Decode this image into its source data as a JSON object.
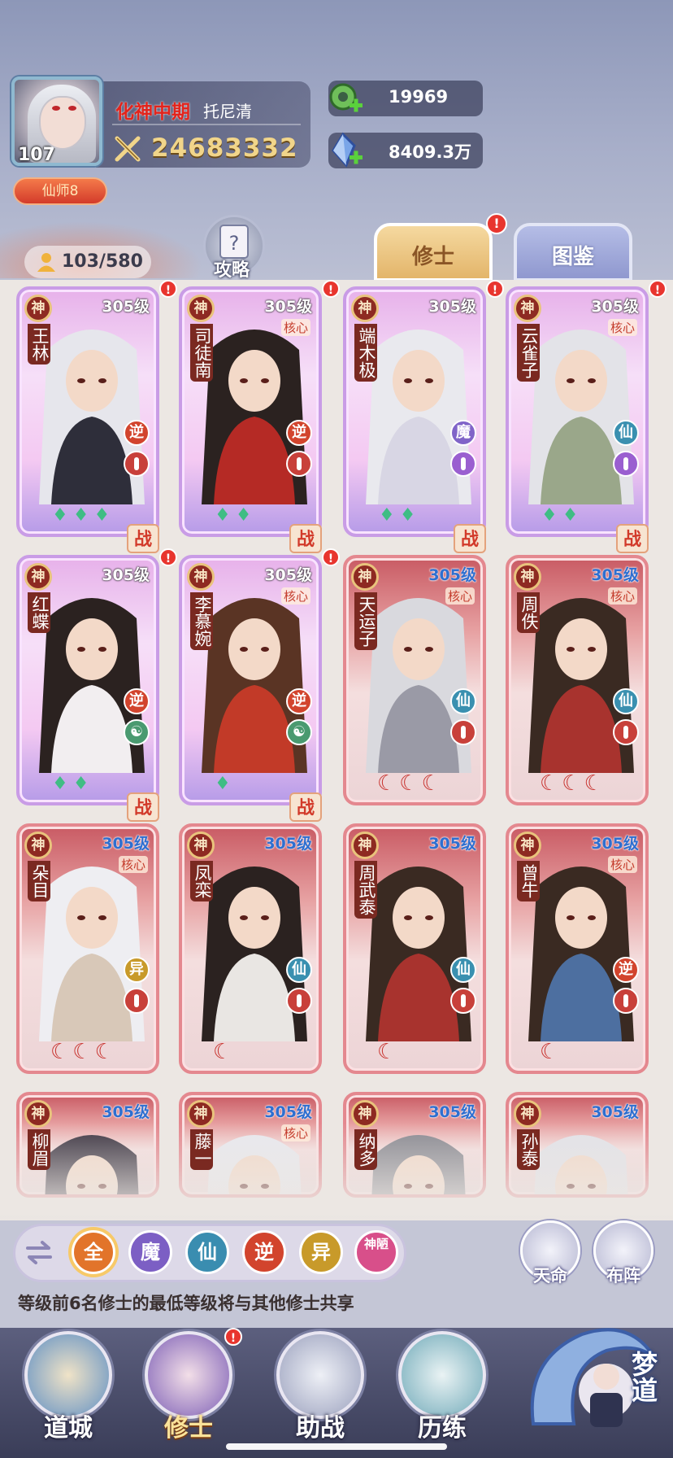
{
  "player": {
    "level": "107",
    "realm": "化神中期",
    "name": "托尼清",
    "power": "24683332",
    "title": "仙师8"
  },
  "resources": [
    {
      "name": "jade-coin",
      "value": "19969"
    },
    {
      "name": "spirit-crystal",
      "value": "8409.3万"
    }
  ],
  "roster": {
    "count": "103/580"
  },
  "strategy": {
    "label": "攻略"
  },
  "tabs": [
    {
      "label": "修士",
      "active": true
    },
    {
      "label": "图鉴",
      "active": false
    }
  ],
  "cards": [
    {
      "badge": "神",
      "name": "王林",
      "level": "305级",
      "core": "",
      "faction": "逆",
      "role": "attack",
      "pips": "♦♦♦",
      "style": "gold",
      "deployed": true
    },
    {
      "badge": "神",
      "name": "司徒南",
      "level": "305级",
      "core": "核心",
      "faction": "逆",
      "role": "attack",
      "pips": "♦♦",
      "style": "gold",
      "deployed": true
    },
    {
      "badge": "神",
      "name": "端木极",
      "level": "305级",
      "core": "",
      "faction": "魔",
      "role": "heal",
      "pips": "♦♦",
      "style": "gold",
      "deployed": true
    },
    {
      "badge": "神",
      "name": "云雀子",
      "level": "305级",
      "core": "核心",
      "faction": "仙",
      "role": "heal",
      "pips": "♦♦",
      "style": "gold",
      "deployed": true
    },
    {
      "badge": "神",
      "name": "红蝶",
      "level": "305级",
      "core": "",
      "faction": "逆",
      "role": "yinyang",
      "pips": "♦♦",
      "style": "gold",
      "deployed": true
    },
    {
      "badge": "神",
      "name": "李慕婉",
      "level": "305级",
      "core": "核心",
      "faction": "逆",
      "role": "yinyang",
      "pips": "♦",
      "style": "gold",
      "deployed": true
    },
    {
      "badge": "神",
      "name": "天运子",
      "level": "305级",
      "core": "核心",
      "faction": "仙",
      "role": "attack",
      "moons": "☾☾☾",
      "style": "red",
      "deployed": false
    },
    {
      "badge": "神",
      "name": "周佚",
      "level": "305级",
      "core": "核心",
      "faction": "仙",
      "role": "attack",
      "moons": "☾☾☾",
      "style": "red",
      "deployed": false
    },
    {
      "badge": "神",
      "name": "朵目",
      "level": "305级",
      "core": "核心",
      "faction": "异",
      "role": "attack",
      "moons": "☾☾☾",
      "style": "red",
      "deployed": false
    },
    {
      "badge": "神",
      "name": "凤栾",
      "level": "305级",
      "core": "",
      "faction": "仙",
      "role": "attack",
      "moons": "☾",
      "style": "red",
      "deployed": false
    },
    {
      "badge": "神",
      "name": "周武泰",
      "level": "305级",
      "core": "",
      "faction": "仙",
      "role": "attack",
      "moons": "☾",
      "style": "red",
      "deployed": false
    },
    {
      "badge": "神",
      "name": "曾牛",
      "level": "305级",
      "core": "核心",
      "faction": "逆",
      "role": "attack",
      "moons": "☾",
      "style": "red",
      "deployed": false
    },
    {
      "badge": "神",
      "name": "柳眉",
      "level": "305级",
      "core": "",
      "style": "red"
    },
    {
      "badge": "神",
      "name": "藤一",
      "level": "305级",
      "core": "核心",
      "style": "red"
    },
    {
      "badge": "神",
      "name": "纳多",
      "level": "305级",
      "core": "",
      "style": "red"
    },
    {
      "badge": "神",
      "name": "孙泰",
      "level": "305级",
      "core": "",
      "style": "red"
    }
  ],
  "deployed_label": "战",
  "notification_mark": "!",
  "filters": [
    {
      "label": "全",
      "color": "#e2742a"
    },
    {
      "label": "魔",
      "color": "#7c5fc4"
    },
    {
      "label": "仙",
      "color": "#3a8db0"
    },
    {
      "label": "逆",
      "color": "#d2442d"
    },
    {
      "label": "异",
      "color": "#c89a2a"
    },
    {
      "label": "神陋",
      "color": "#d84f8a"
    }
  ],
  "side_buttons": [
    {
      "label": "天命"
    },
    {
      "label": "布阵"
    }
  ],
  "hint": "等级前6名修士的最低等级将与其他修士共享",
  "nav": [
    {
      "label": "道城"
    },
    {
      "label": "修士",
      "active": true
    },
    {
      "label": "助战"
    },
    {
      "label": "历练"
    }
  ],
  "mengdao": {
    "label": "梦道"
  },
  "colors": {
    "accent_red": "#e2241c",
    "power_gold": "#f1d58a",
    "level_blue": "#2e6fd0"
  }
}
